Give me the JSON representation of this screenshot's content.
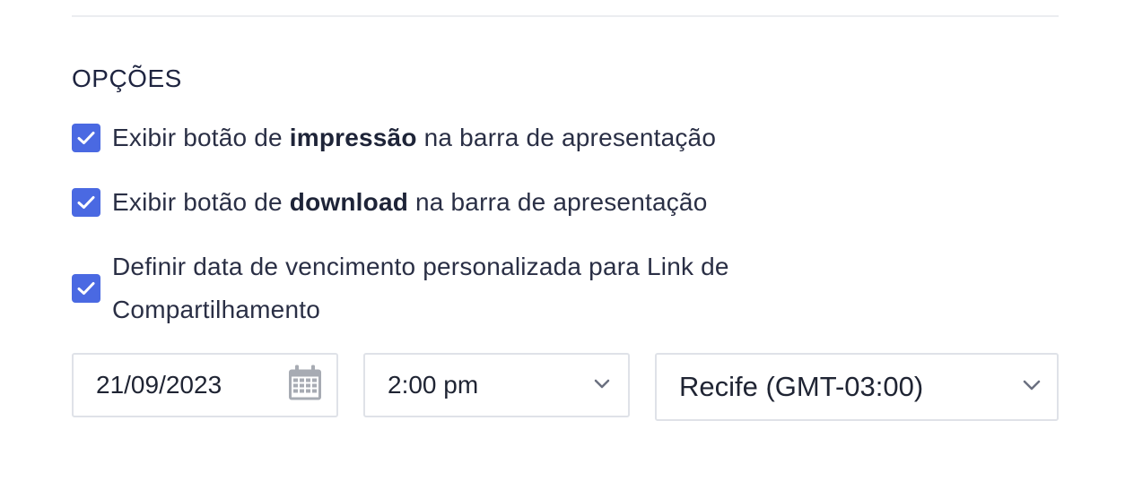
{
  "options_section": {
    "title": "OPÇÕES",
    "options": [
      {
        "checked": true,
        "label_before": "Exibir botão de ",
        "label_bold": "impressão",
        "label_after": " na barra de apresentação"
      },
      {
        "checked": true,
        "label_before": "Exibir botão de ",
        "label_bold": "download",
        "label_after": " na barra de apresentação"
      },
      {
        "checked": true,
        "label": "Definir data de vencimento personalizada para Link de Compartilhamento"
      }
    ]
  },
  "expiration": {
    "date": "21/09/2023",
    "date_icon": "calendar-icon",
    "time": "2:00 pm",
    "timezone": "Recife (GMT-03:00)",
    "dropdown_icon": "chevron-down-icon"
  },
  "colors": {
    "checkbox_accent": "#4a69e2",
    "title_text": "#1e2440",
    "border": "#dfe2e8",
    "icon_gray": "#a7abb3"
  }
}
